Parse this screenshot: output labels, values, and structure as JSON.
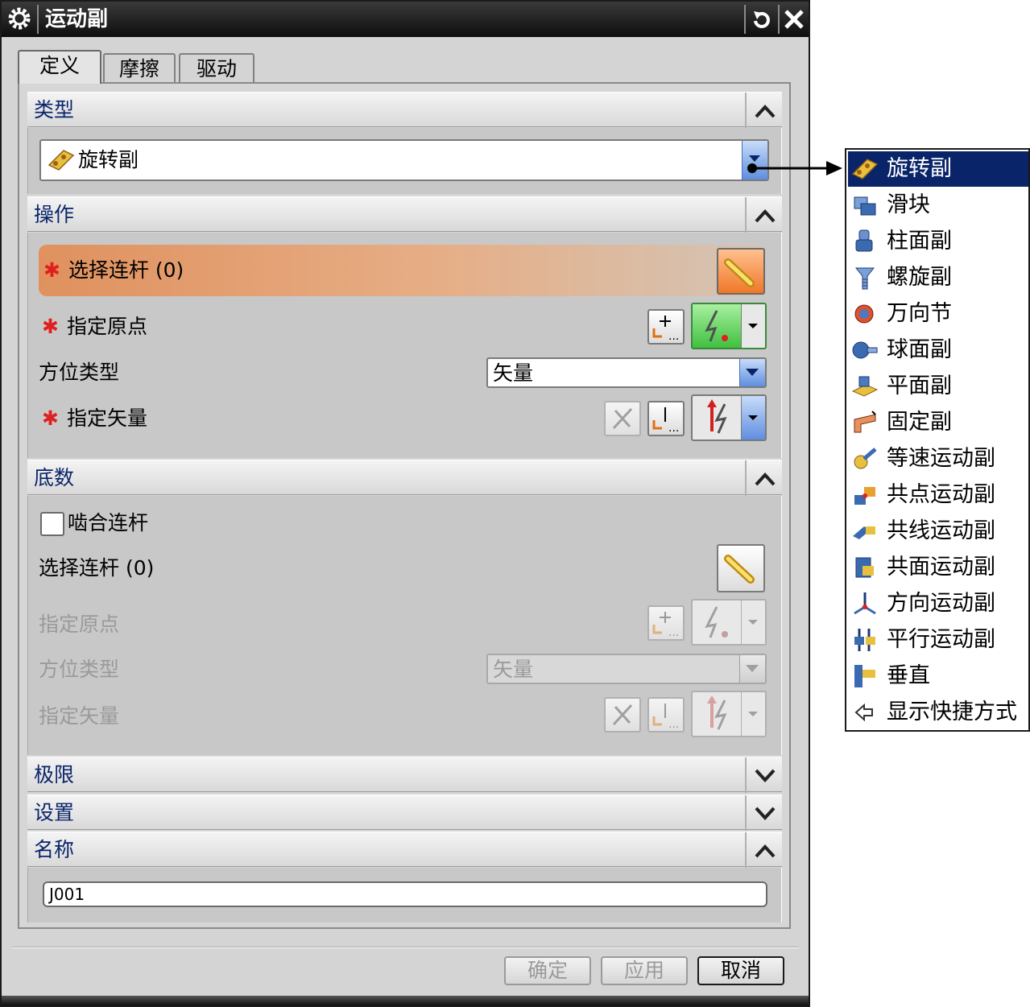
{
  "window": {
    "title": "运动副"
  },
  "tabs": [
    {
      "label": "定义",
      "active": true
    },
    {
      "label": "摩擦",
      "active": false
    },
    {
      "label": "驱动",
      "active": false
    }
  ],
  "sections": {
    "type": {
      "title": "类型",
      "selected": "旋转副",
      "selected_icon": "revolute-joint-icon"
    },
    "action": {
      "title": "操作",
      "select_link": "选择连杆 (0)",
      "specify_origin": "指定原点",
      "orientation_type_label": "方位类型",
      "orientation_value": "矢量",
      "specify_vector": "指定矢量",
      "required_mark": "✱"
    },
    "base": {
      "title": "底数",
      "mesh_link": "啮合连杆",
      "mesh_link_checked": false,
      "select_link": "选择连杆 (0)",
      "specify_origin": "指定原点",
      "orientation_type_label": "方位类型",
      "orientation_value": "矢量",
      "specify_vector": "指定矢量"
    },
    "limits": {
      "title": "极限"
    },
    "settings": {
      "title": "设置"
    },
    "name": {
      "title": "名称",
      "value": "J001"
    }
  },
  "footer": {
    "ok": "确定",
    "apply": "应用",
    "cancel": "取消"
  },
  "joint_types": [
    {
      "label": "旋转副",
      "icon": "revolute-joint-icon",
      "selected": true
    },
    {
      "label": "滑块",
      "icon": "slider-joint-icon"
    },
    {
      "label": "柱面副",
      "icon": "cylindrical-joint-icon"
    },
    {
      "label": "螺旋副",
      "icon": "screw-joint-icon"
    },
    {
      "label": "万向节",
      "icon": "universal-joint-icon"
    },
    {
      "label": "球面副",
      "icon": "spherical-joint-icon"
    },
    {
      "label": "平面副",
      "icon": "planar-joint-icon"
    },
    {
      "label": "固定副",
      "icon": "fixed-joint-icon"
    },
    {
      "label": "等速运动副",
      "icon": "constant-velocity-joint-icon"
    },
    {
      "label": "共点运动副",
      "icon": "atpoint-joint-icon"
    },
    {
      "label": "共线运动副",
      "icon": "inline-joint-icon"
    },
    {
      "label": "共面运动副",
      "icon": "inplane-joint-icon"
    },
    {
      "label": "方向运动副",
      "icon": "orientation-joint-icon"
    },
    {
      "label": "平行运动副",
      "icon": "parallel-joint-icon"
    },
    {
      "label": "垂直",
      "icon": "perpendicular-joint-icon"
    },
    {
      "label": "显示快捷方式",
      "icon": "arrow-left-icon"
    }
  ],
  "colors": {
    "accent": "#0a246a",
    "highlight": "#e0915e",
    "required": "#e02020",
    "combo_button": "#5f8ee0"
  }
}
